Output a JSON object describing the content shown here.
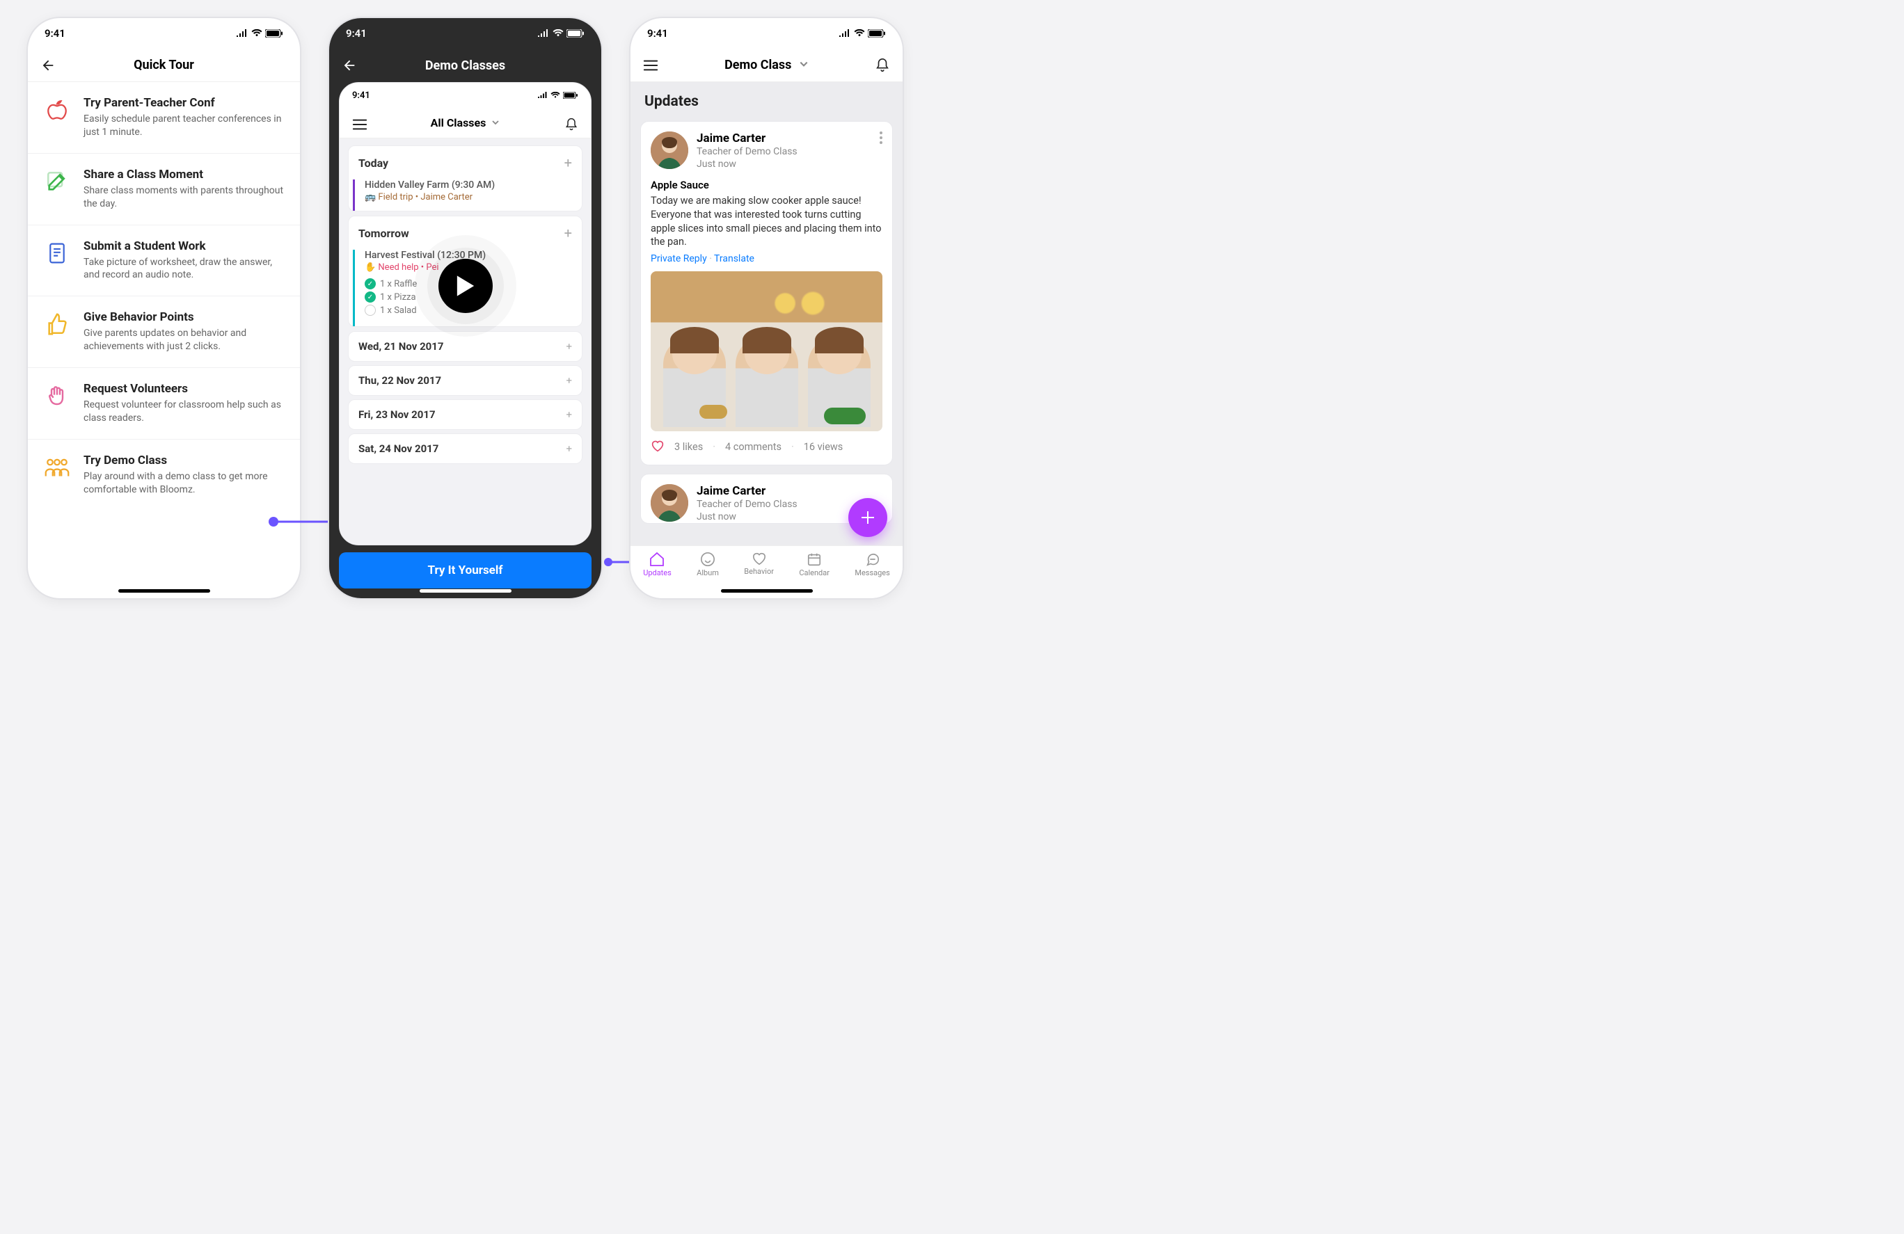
{
  "status": {
    "time": "9:41"
  },
  "screen1": {
    "title": "Quick Tour",
    "rows": [
      {
        "icon": "apple-icon",
        "color": "#e24a4a",
        "title": "Try Parent-Teacher Conf",
        "sub": "Easily schedule parent teacher conferences in just 1 minute."
      },
      {
        "icon": "edit-icon",
        "color": "#3bb54a",
        "title": "Share a Class Moment",
        "sub": "Share class moments with parents throughout the day."
      },
      {
        "icon": "document-icon",
        "color": "#3a63d6",
        "title": "Submit a Student Work",
        "sub": "Take picture of worksheet, draw the answer, and record an audio note."
      },
      {
        "icon": "thumbs-up-icon",
        "color": "#f0b72b",
        "title": "Give Behavior Points",
        "sub": "Give parents updates on behavior and achievements with just 2 clicks."
      },
      {
        "icon": "hand-icon",
        "color": "#e56aa0",
        "title": "Request Volunteers",
        "sub": "Request volunteer for classroom help such as class readers."
      },
      {
        "icon": "people-icon",
        "color": "#f0a82b",
        "title": "Try Demo Class",
        "sub": "Play around with a demo class to get more comfortable with Bloomz."
      }
    ]
  },
  "screen2": {
    "title": "Demo Classes",
    "innerTitle": "All Classes",
    "today": {
      "label": "Today",
      "event": {
        "title": "Hidden Valley Farm (9:30 AM)",
        "meta": "🚌 Field trip  •  Jaime Carter"
      }
    },
    "tomorrow": {
      "label": "Tomorrow",
      "event": {
        "title": "Harvest Festival (12:30 PM)",
        "need": "✋ Need help  •  Pei",
        "items": [
          {
            "done": true,
            "label": "1 x Raffle"
          },
          {
            "done": true,
            "label": "1 x Pizza"
          },
          {
            "done": false,
            "label": "1 x Salad"
          }
        ]
      }
    },
    "dates": [
      "Wed, 21 Nov 2017",
      "Thu, 22 Nov 2017",
      "Fri, 23 Nov 2017",
      "Sat, 24 Nov 2017"
    ],
    "cta": "Try It Yourself"
  },
  "screen3": {
    "classTitle": "Demo Class",
    "updatesLabel": "Updates",
    "post": {
      "author": "Jaime Carter",
      "role": "Teacher of Demo Class",
      "time": "Just now",
      "title": "Apple Sauce",
      "body": "Today we are making slow cooker apple sauce! Everyone that was interested took turns cutting apple slices into small pieces and placing them into the pan.",
      "privateReply": "Private Reply",
      "translate": "Translate",
      "likes": "3 likes",
      "comments": "4 comments",
      "views": "16 views"
    },
    "post2": {
      "author": "Jaime Carter",
      "role": "Teacher of Demo Class",
      "time": "Just now"
    },
    "tabs": [
      "Updates",
      "Album",
      "Behavior",
      "Calendar",
      "Messages"
    ]
  }
}
